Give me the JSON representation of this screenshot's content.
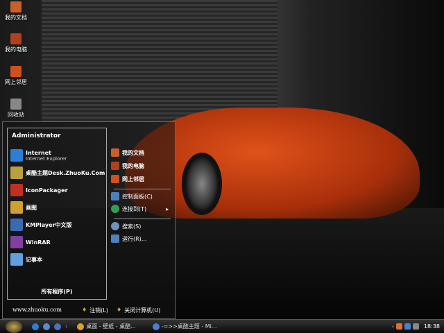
{
  "desktop_icons": [
    {
      "label": "我的文档",
      "color": "#c8602a"
    },
    {
      "label": "我的电脑",
      "color": "#b04020"
    },
    {
      "label": "网上邻居",
      "color": "#d05020"
    },
    {
      "label": "回收站",
      "color": "#888888"
    }
  ],
  "start_menu": {
    "user": "Administrator",
    "programs": [
      {
        "label": "Internet",
        "sub": "Internet Explorer",
        "icon": "ie-icon",
        "color": "#2a7fd8"
      },
      {
        "label": "桌酷主题Desk.ZhuoKu.Com",
        "icon": "zhuoku-icon",
        "color": "#b8a040"
      },
      {
        "label": "IconPackager",
        "icon": "iconpackager-icon",
        "color": "#c03020"
      },
      {
        "label": "画图",
        "icon": "paint-icon",
        "color": "#d0a030"
      },
      {
        "label": "KMPlayer中文版",
        "icon": "kmplayer-icon",
        "color": "#3a6ab0"
      },
      {
        "label": "WinRAR",
        "icon": "winrar-icon",
        "color": "#8040a0"
      },
      {
        "label": "记事本",
        "icon": "notepad-icon",
        "color": "#60a0e0"
      }
    ],
    "all_programs": "所有程序(P)",
    "places": [
      {
        "label": "我的文档",
        "color": "#c8602a"
      },
      {
        "label": "我的电脑",
        "color": "#b04020"
      },
      {
        "label": "网上邻居",
        "color": "#d05020"
      }
    ],
    "settings": [
      {
        "label": "控制面板(C)",
        "color": "#4a80c0"
      },
      {
        "label": "连接到(T)",
        "color": "#30a050"
      }
    ],
    "tools": [
      {
        "label": "搜索(S)",
        "color": "#7090c0"
      },
      {
        "label": "运行(R)...",
        "color": "#5080c0"
      }
    ],
    "website": "www.zhuoku.com",
    "logoff": "注销(L)",
    "shutdown": "关闭计算机(U)"
  },
  "taskbar": {
    "tasks": [
      {
        "label": "桌面 - 壁纸 - 桌酷...",
        "color": "#e0a020"
      },
      {
        "label": "-=>>桌酷主题 - Mi...",
        "color": "#4a80d0"
      }
    ],
    "clock": "18:38"
  }
}
